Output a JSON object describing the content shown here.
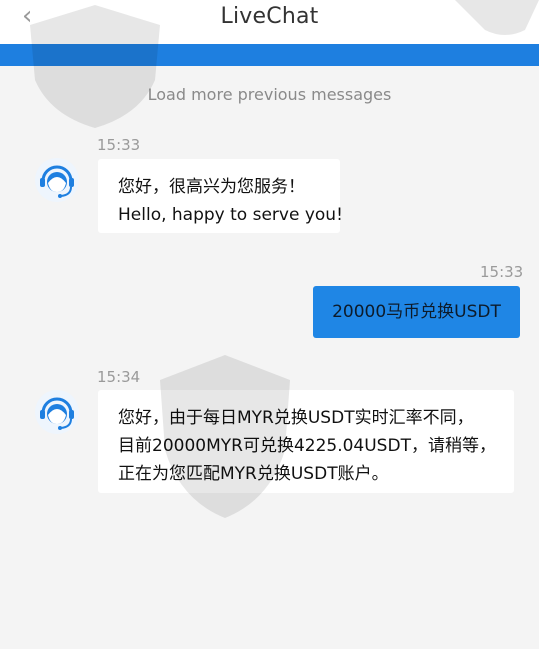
{
  "header": {
    "back_icon": "chevron-left-icon",
    "title": "LiveChat"
  },
  "colors": {
    "accent": "#1e7fe0",
    "outgoing_bubble": "#1f86e5",
    "incoming_bubble": "#ffffff",
    "background": "#f4f4f4"
  },
  "load_more": "Load more previous messages",
  "messages": [
    {
      "direction": "incoming",
      "time": "15:33",
      "avatar_icon": "support-agent-icon",
      "lines": [
        "您好，很高兴为您服务！",
        "Hello, happy to serve you!"
      ]
    },
    {
      "direction": "outgoing",
      "time": "15:33",
      "lines": [
        "20000马币兑换USDT"
      ]
    },
    {
      "direction": "incoming",
      "time": "15:34",
      "avatar_icon": "support-agent-icon",
      "lines": [
        "您好，由于每日MYR兑换USDT实时汇率不同，",
        "目前20000MYR可兑换4225.04USDT，请稍等，",
        "正在为您匹配MYR兑换USDT账户。"
      ]
    }
  ]
}
